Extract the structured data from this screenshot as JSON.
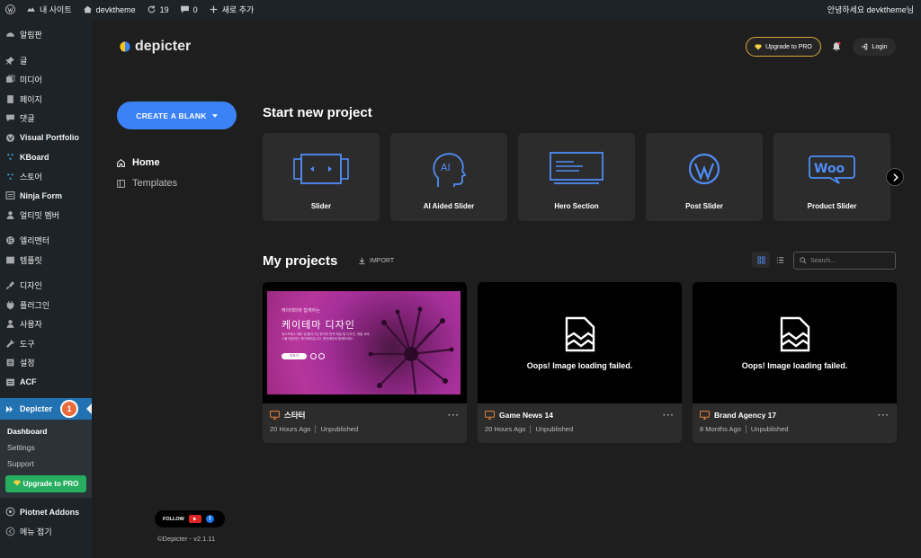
{
  "adminbar": {
    "site_name": "내 사이트",
    "theme_name": "devktheme",
    "updates_count": "19",
    "comments_count": "0",
    "new_label": "새로 추가",
    "greeting": "안녕하세요 devktheme님"
  },
  "wp_menu": {
    "items": [
      {
        "label": "알림판",
        "icon": "dashboard-icon"
      },
      {
        "label": "글",
        "icon": "pin-icon"
      },
      {
        "label": "미디어",
        "icon": "media-icon"
      },
      {
        "label": "페이지",
        "icon": "page-icon"
      },
      {
        "label": "댓글",
        "icon": "comment-icon"
      },
      {
        "label": "Visual Portfolio",
        "icon": "portfolio-icon"
      },
      {
        "label": "KBoard",
        "icon": "kboard-icon"
      },
      {
        "label": "스토어",
        "icon": "store-icon"
      },
      {
        "label": "Ninja Form",
        "icon": "form-icon"
      },
      {
        "label": "얼티밋 멤버",
        "icon": "member-icon"
      },
      {
        "label": "엘리멘터",
        "icon": "elementor-icon"
      },
      {
        "label": "템플릿",
        "icon": "template-icon"
      },
      {
        "label": "디자인",
        "icon": "brush-icon"
      },
      {
        "label": "플러그인",
        "icon": "plugin-icon"
      },
      {
        "label": "사용자",
        "icon": "user-icon"
      },
      {
        "label": "도구",
        "icon": "wrench-icon"
      },
      {
        "label": "설정",
        "icon": "settings-icon"
      },
      {
        "label": "ACF",
        "icon": "acf-icon"
      }
    ],
    "current": {
      "label": "Depicter",
      "badge": "1"
    },
    "submenu": {
      "dashboard": "Dashboard",
      "settings": "Settings",
      "support": "Support",
      "upgrade": "Upgrade to PRO"
    },
    "after": [
      {
        "label": "Piotnet Addons",
        "icon": "piotnet-icon"
      },
      {
        "label": "메뉴 접기",
        "icon": "collapse-icon"
      }
    ]
  },
  "app": {
    "logo_text": "depicter",
    "upgrade_label": "Upgrade to PRO",
    "login_label": "Login",
    "create_label": "CREATE A BLANK",
    "nav": {
      "home": "Home",
      "templates": "Templates"
    },
    "start_title": "Start new project",
    "project_types": [
      {
        "label": "Slider",
        "icon": "slider-icon"
      },
      {
        "label": "AI Aided Slider",
        "icon": "ai-head-icon"
      },
      {
        "label": "Hero Section",
        "icon": "hero-section-icon"
      },
      {
        "label": "Post Slider",
        "icon": "wordpress-icon"
      },
      {
        "label": "Product Slider",
        "icon": "woo-icon"
      }
    ],
    "projects_title": "My projects",
    "import_label": "IMPORT",
    "search_placeholder": "Search...",
    "projects": [
      {
        "name": "스타터",
        "time": "20 Hours Ago",
        "status": "Unpublished",
        "thumb": {
          "kicker": "케이테마와 함께하는",
          "title": "케이테마 디자인",
          "body": "워드프레스 테마 및 플러그인 한국어 번역 제공 및 디자인, 개발 서비스를 제공하는 케이테마입니다. 케이테마와 함께하세요.",
          "button": "더보기"
        }
      },
      {
        "name": "Game News 14",
        "time": "20 Hours Ago",
        "status": "Unpublished",
        "error": "Oops! Image loading failed."
      },
      {
        "name": "Brand Agency 17",
        "time": "8 Months Ago",
        "status": "Unpublished",
        "error": "Oops! Image loading failed."
      }
    ],
    "follow_label": "FOLLOW",
    "copyright": "©Depicter - v2.1.11"
  }
}
